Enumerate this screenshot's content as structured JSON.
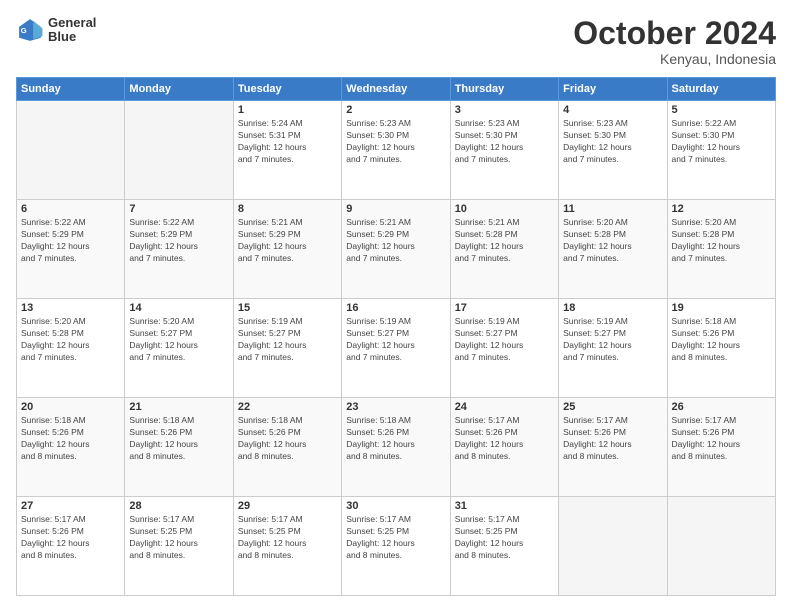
{
  "header": {
    "logo_line1": "General",
    "logo_line2": "Blue",
    "month": "October 2024",
    "location": "Kenyau, Indonesia"
  },
  "weekdays": [
    "Sunday",
    "Monday",
    "Tuesday",
    "Wednesday",
    "Thursday",
    "Friday",
    "Saturday"
  ],
  "weeks": [
    [
      {
        "day": "",
        "info": ""
      },
      {
        "day": "",
        "info": ""
      },
      {
        "day": "1",
        "info": "Sunrise: 5:24 AM\nSunset: 5:31 PM\nDaylight: 12 hours\nand 7 minutes."
      },
      {
        "day": "2",
        "info": "Sunrise: 5:23 AM\nSunset: 5:30 PM\nDaylight: 12 hours\nand 7 minutes."
      },
      {
        "day": "3",
        "info": "Sunrise: 5:23 AM\nSunset: 5:30 PM\nDaylight: 12 hours\nand 7 minutes."
      },
      {
        "day": "4",
        "info": "Sunrise: 5:23 AM\nSunset: 5:30 PM\nDaylight: 12 hours\nand 7 minutes."
      },
      {
        "day": "5",
        "info": "Sunrise: 5:22 AM\nSunset: 5:30 PM\nDaylight: 12 hours\nand 7 minutes."
      }
    ],
    [
      {
        "day": "6",
        "info": "Sunrise: 5:22 AM\nSunset: 5:29 PM\nDaylight: 12 hours\nand 7 minutes."
      },
      {
        "day": "7",
        "info": "Sunrise: 5:22 AM\nSunset: 5:29 PM\nDaylight: 12 hours\nand 7 minutes."
      },
      {
        "day": "8",
        "info": "Sunrise: 5:21 AM\nSunset: 5:29 PM\nDaylight: 12 hours\nand 7 minutes."
      },
      {
        "day": "9",
        "info": "Sunrise: 5:21 AM\nSunset: 5:29 PM\nDaylight: 12 hours\nand 7 minutes."
      },
      {
        "day": "10",
        "info": "Sunrise: 5:21 AM\nSunset: 5:28 PM\nDaylight: 12 hours\nand 7 minutes."
      },
      {
        "day": "11",
        "info": "Sunrise: 5:20 AM\nSunset: 5:28 PM\nDaylight: 12 hours\nand 7 minutes."
      },
      {
        "day": "12",
        "info": "Sunrise: 5:20 AM\nSunset: 5:28 PM\nDaylight: 12 hours\nand 7 minutes."
      }
    ],
    [
      {
        "day": "13",
        "info": "Sunrise: 5:20 AM\nSunset: 5:28 PM\nDaylight: 12 hours\nand 7 minutes."
      },
      {
        "day": "14",
        "info": "Sunrise: 5:20 AM\nSunset: 5:27 PM\nDaylight: 12 hours\nand 7 minutes."
      },
      {
        "day": "15",
        "info": "Sunrise: 5:19 AM\nSunset: 5:27 PM\nDaylight: 12 hours\nand 7 minutes."
      },
      {
        "day": "16",
        "info": "Sunrise: 5:19 AM\nSunset: 5:27 PM\nDaylight: 12 hours\nand 7 minutes."
      },
      {
        "day": "17",
        "info": "Sunrise: 5:19 AM\nSunset: 5:27 PM\nDaylight: 12 hours\nand 7 minutes."
      },
      {
        "day": "18",
        "info": "Sunrise: 5:19 AM\nSunset: 5:27 PM\nDaylight: 12 hours\nand 7 minutes."
      },
      {
        "day": "19",
        "info": "Sunrise: 5:18 AM\nSunset: 5:26 PM\nDaylight: 12 hours\nand 8 minutes."
      }
    ],
    [
      {
        "day": "20",
        "info": "Sunrise: 5:18 AM\nSunset: 5:26 PM\nDaylight: 12 hours\nand 8 minutes."
      },
      {
        "day": "21",
        "info": "Sunrise: 5:18 AM\nSunset: 5:26 PM\nDaylight: 12 hours\nand 8 minutes."
      },
      {
        "day": "22",
        "info": "Sunrise: 5:18 AM\nSunset: 5:26 PM\nDaylight: 12 hours\nand 8 minutes."
      },
      {
        "day": "23",
        "info": "Sunrise: 5:18 AM\nSunset: 5:26 PM\nDaylight: 12 hours\nand 8 minutes."
      },
      {
        "day": "24",
        "info": "Sunrise: 5:17 AM\nSunset: 5:26 PM\nDaylight: 12 hours\nand 8 minutes."
      },
      {
        "day": "25",
        "info": "Sunrise: 5:17 AM\nSunset: 5:26 PM\nDaylight: 12 hours\nand 8 minutes."
      },
      {
        "day": "26",
        "info": "Sunrise: 5:17 AM\nSunset: 5:26 PM\nDaylight: 12 hours\nand 8 minutes."
      }
    ],
    [
      {
        "day": "27",
        "info": "Sunrise: 5:17 AM\nSunset: 5:26 PM\nDaylight: 12 hours\nand 8 minutes."
      },
      {
        "day": "28",
        "info": "Sunrise: 5:17 AM\nSunset: 5:25 PM\nDaylight: 12 hours\nand 8 minutes."
      },
      {
        "day": "29",
        "info": "Sunrise: 5:17 AM\nSunset: 5:25 PM\nDaylight: 12 hours\nand 8 minutes."
      },
      {
        "day": "30",
        "info": "Sunrise: 5:17 AM\nSunset: 5:25 PM\nDaylight: 12 hours\nand 8 minutes."
      },
      {
        "day": "31",
        "info": "Sunrise: 5:17 AM\nSunset: 5:25 PM\nDaylight: 12 hours\nand 8 minutes."
      },
      {
        "day": "",
        "info": ""
      },
      {
        "day": "",
        "info": ""
      }
    ]
  ]
}
